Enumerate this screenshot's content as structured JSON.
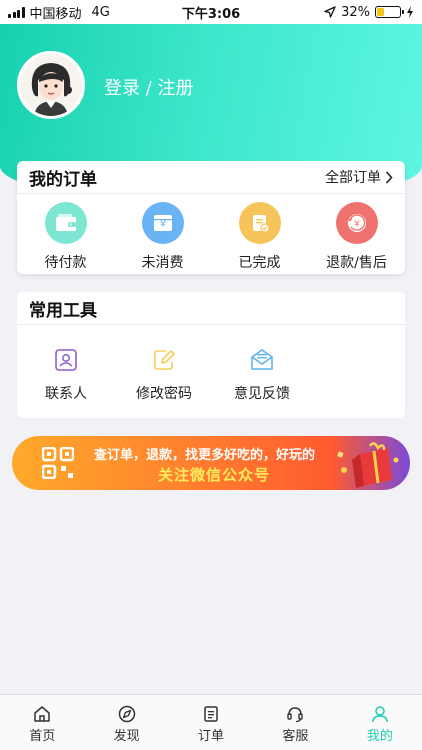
{
  "status_bar": {
    "carrier": "中国移动",
    "network": "4G",
    "time": "下午3:06",
    "battery": "32%",
    "battery_level": 0.32
  },
  "profile": {
    "login_text": "登录 / 注册"
  },
  "orders": {
    "title": "我的订单",
    "more": "全部订单",
    "items": [
      {
        "label": "待付款",
        "icon": "wallet-icon",
        "color": "#7de7d3"
      },
      {
        "label": "未消费",
        "icon": "coupon-icon",
        "color": "#6ab3f5"
      },
      {
        "label": "已完成",
        "icon": "checklist-icon",
        "color": "#f6c45a"
      },
      {
        "label": "退款/售后",
        "icon": "refund-icon",
        "color": "#f0726e"
      }
    ]
  },
  "tools": {
    "title": "常用工具",
    "items": [
      {
        "label": "联系人",
        "icon": "contact-icon",
        "color": "#8b5cd6"
      },
      {
        "label": "修改密码",
        "icon": "edit-icon",
        "color": "#f5cf5a"
      },
      {
        "label": "意见反馈",
        "icon": "feedback-icon",
        "color": "#5fb3ee"
      }
    ]
  },
  "banner": {
    "line1": "查订单，退款，找更多好吃的，好玩的",
    "line2": "关注微信公众号"
  },
  "tabbar": {
    "items": [
      {
        "label": "首页",
        "icon": "home-icon"
      },
      {
        "label": "发现",
        "icon": "compass-icon"
      },
      {
        "label": "订单",
        "icon": "order-list-icon"
      },
      {
        "label": "客服",
        "icon": "headset-icon"
      },
      {
        "label": "我的",
        "icon": "user-icon",
        "active": true
      }
    ],
    "active_color": "#1fcdb0"
  }
}
